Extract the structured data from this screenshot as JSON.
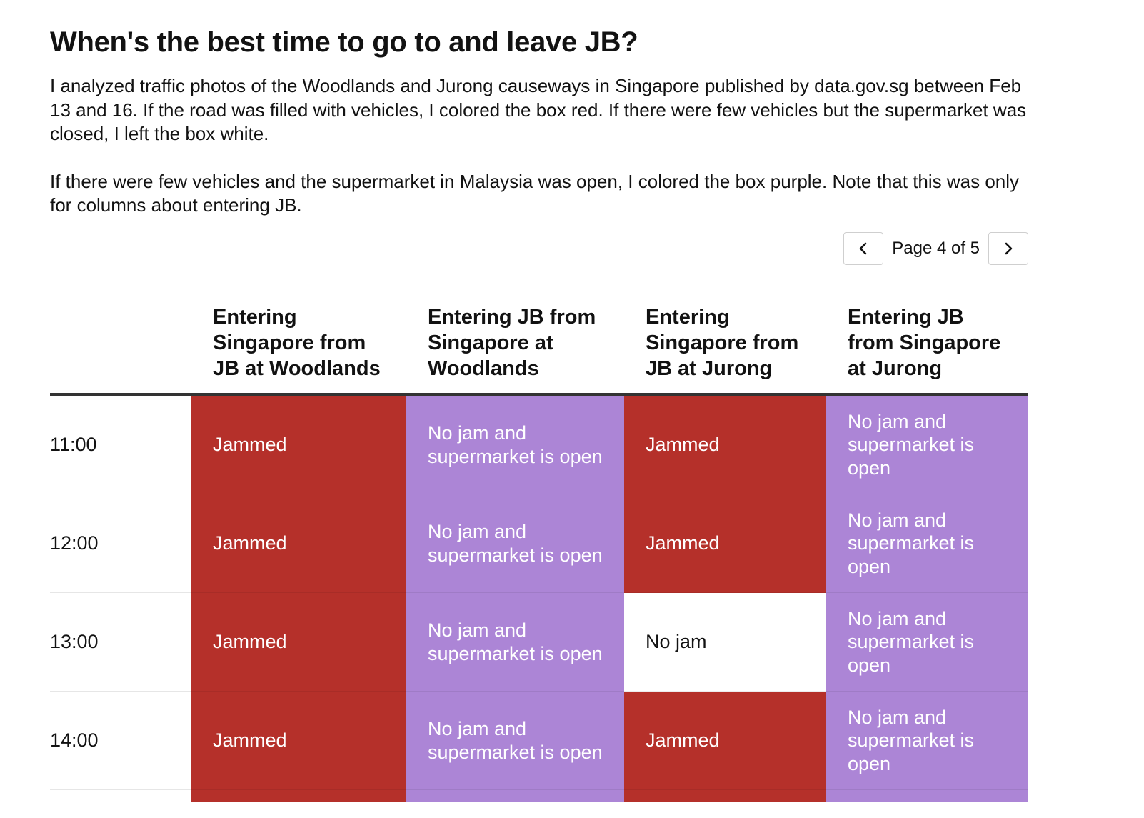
{
  "title": "When's the best time to go to and leave JB?",
  "intro": {
    "paragraph_1": "I analyzed traffic photos of the Woodlands and Jurong causeways in Singapore published by data.gov.sg between Feb 13 and 16. If the road was filled with vehicles, I colored the box red. If there were few vehicles but the supermarket was closed, I left the box white.",
    "paragraph_2": "If there were few vehicles and the supermarket in Malaysia was open, I colored the box purple. Note that this was only for columns about entering JB."
  },
  "pager": {
    "prev_icon": "chevron-left-icon",
    "label": "Page 4 of 5",
    "next_icon": "chevron-right-icon"
  },
  "colors": {
    "jammed": "#b5302a",
    "open": "#ac85d6",
    "no_jam": "#ffffff"
  },
  "table": {
    "columns": [
      "",
      "Entering Singapore from JB at Woodlands",
      "Entering JB from Singapore at Woodlands",
      "Entering Singapore from JB at Jurong",
      "Entering JB from Singapore at Jurong"
    ],
    "rows": [
      {
        "time": "11:00",
        "cells": [
          {
            "text": "Jammed",
            "status": "jammed"
          },
          {
            "text": "No jam and supermarket is open",
            "status": "open"
          },
          {
            "text": "Jammed",
            "status": "jammed"
          },
          {
            "text": "No jam and supermarket is open",
            "status": "open"
          }
        ]
      },
      {
        "time": "12:00",
        "cells": [
          {
            "text": "Jammed",
            "status": "jammed"
          },
          {
            "text": "No jam and supermarket is open",
            "status": "open"
          },
          {
            "text": "Jammed",
            "status": "jammed"
          },
          {
            "text": "No jam and supermarket is open",
            "status": "open"
          }
        ]
      },
      {
        "time": "13:00",
        "cells": [
          {
            "text": "Jammed",
            "status": "jammed"
          },
          {
            "text": "No jam and supermarket is open",
            "status": "open"
          },
          {
            "text": "No jam",
            "status": "nojam"
          },
          {
            "text": "No jam and supermarket is open",
            "status": "open"
          }
        ]
      },
      {
        "time": "14:00",
        "cells": [
          {
            "text": "Jammed",
            "status": "jammed"
          },
          {
            "text": "No jam and supermarket is open",
            "status": "open"
          },
          {
            "text": "Jammed",
            "status": "jammed"
          },
          {
            "text": "No jam and supermarket is open",
            "status": "open"
          }
        ]
      }
    ]
  }
}
